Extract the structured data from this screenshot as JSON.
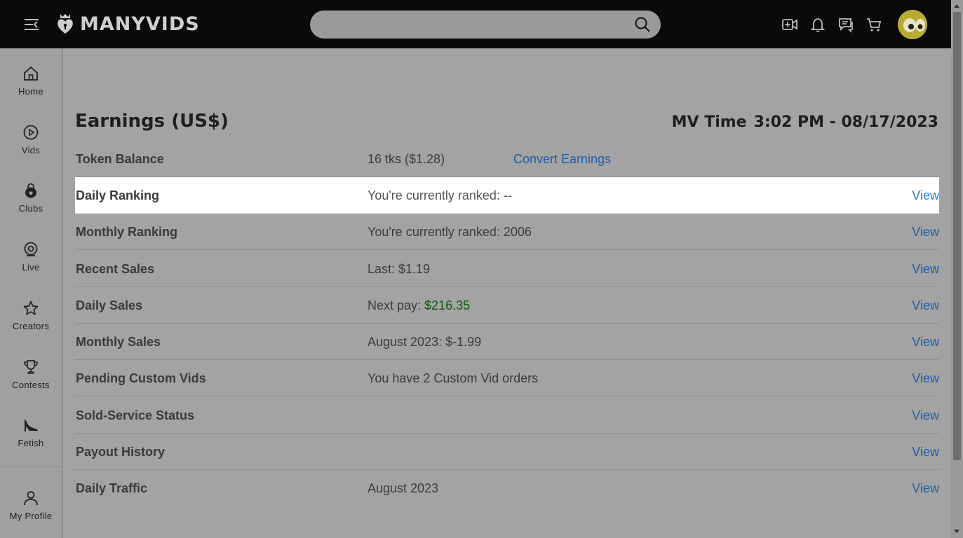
{
  "header": {
    "logo_text": "MANYVIDS",
    "search_placeholder": ""
  },
  "sidebar": {
    "items": [
      {
        "label": "Home",
        "icon": "home-icon"
      },
      {
        "label": "Vids",
        "icon": "play-icon"
      },
      {
        "label": "Clubs",
        "icon": "lock-heart-icon"
      },
      {
        "label": "Live",
        "icon": "webcam-icon"
      },
      {
        "label": "Creators",
        "icon": "star-icon"
      },
      {
        "label": "Contests",
        "icon": "trophy-icon"
      },
      {
        "label": "Fetish",
        "icon": "heel-icon"
      }
    ],
    "profile_label": "My Profile"
  },
  "page": {
    "title": "Earnings (US$)",
    "mv_time_label": "MV Time",
    "mv_time_value": "3:02 PM - 08/17/2023"
  },
  "rows": [
    {
      "label": "Token Balance",
      "value": "16 tks ($1.28)",
      "action": "Convert Earnings"
    },
    {
      "label": "Daily Ranking",
      "value": "You're currently ranked: --",
      "view": "View"
    },
    {
      "label": "Monthly Ranking",
      "value": "You're currently ranked: 2006",
      "view": "View"
    },
    {
      "label": "Recent Sales",
      "value": "Last: $1.19",
      "view": "View"
    },
    {
      "label": "Daily Sales",
      "value_prefix": "Next pay: ",
      "value_amount": "$216.35",
      "view": "View"
    },
    {
      "label": "Monthly Sales",
      "value": "August 2023: $-1.99",
      "view": "View"
    },
    {
      "label": "Pending Custom Vids",
      "value": "You have 2 Custom Vid orders",
      "view": "View"
    },
    {
      "label": "Sold-Service Status",
      "value": "",
      "view": "View"
    },
    {
      "label": "Payout History",
      "value": "",
      "view": "View"
    },
    {
      "label": "Daily Traffic",
      "value": "August 2023",
      "view": "View"
    }
  ],
  "colors": {
    "link": "#1f5fa8",
    "positive": "#0f5a12",
    "alert": "#b5193f"
  }
}
